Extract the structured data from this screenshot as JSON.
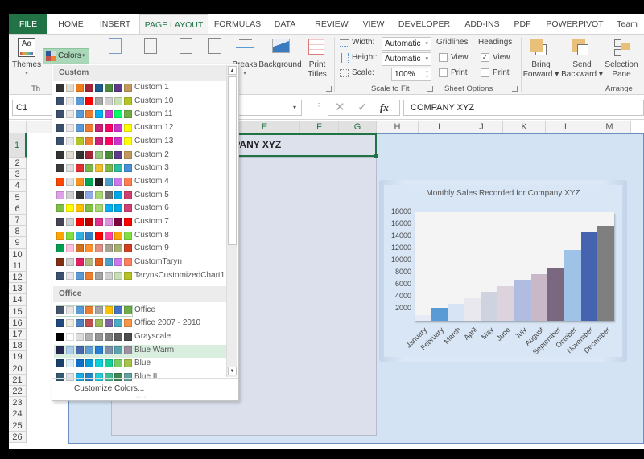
{
  "tabs": [
    "FILE",
    "HOME",
    "INSERT",
    "PAGE LAYOUT",
    "FORMULAS",
    "DATA",
    "REVIEW",
    "VIEW",
    "DEVELOPER",
    "ADD-INS",
    "PDF",
    "POWERPIVOT",
    "Team"
  ],
  "active_tab": "PAGE LAYOUT",
  "ribbon": {
    "themes_label": "Themes",
    "themes_group_label": "Th",
    "colors_label": "Colors",
    "breaks_label": "Breaks",
    "background_label": "Background",
    "print_titles_label": [
      "Print",
      "Titles"
    ],
    "scale_to_fit": {
      "width_label": "Width:",
      "width_value": "Automatic",
      "height_label": "Height:",
      "height_value": "Automatic",
      "scale_label": "Scale:",
      "scale_value": "100%",
      "group_label": "Scale to Fit"
    },
    "sheet_options": {
      "gridlines_label": "Gridlines",
      "headings_label": "Headings",
      "view_label": "View",
      "print_label": "Print",
      "gridlines_view": false,
      "gridlines_print": false,
      "headings_view": true,
      "headings_print": false,
      "group_label": "Sheet Options"
    },
    "arrange": {
      "bring_forward": [
        "Bring",
        "Forward"
      ],
      "send_backward": [
        "Send",
        "Backward"
      ],
      "selection_pane": [
        "Selection",
        "Pane"
      ],
      "group_label": "Arrange"
    }
  },
  "formula_bar": {
    "name_box": "C1",
    "formula": "COMPANY XYZ"
  },
  "columns": [
    "E",
    "F",
    "G",
    "H",
    "I",
    "J",
    "K",
    "L",
    "M"
  ],
  "rows": [
    "1",
    "2",
    "3",
    "4",
    "5",
    "6",
    "7",
    "8",
    "9",
    "10",
    "11",
    "12",
    "13",
    "14",
    "15",
    "16",
    "17",
    "18",
    "19",
    "20",
    "21",
    "22",
    "23",
    "24",
    "25",
    "26"
  ],
  "cell_c1_visible_text": "IPANY XYZ",
  "colors_dropdown": {
    "sections": [
      {
        "title": "Custom",
        "items": [
          {
            "name": "Custom 1",
            "swatches": [
              "#333333",
              "#e0dcd0",
              "#f07d1a",
              "#a32638",
              "#1d5c8a",
              "#4b8b3b",
              "#5e3b8a",
              "#c19a5b"
            ]
          },
          {
            "name": "Custom 10",
            "swatches": [
              "#3d4f6e",
              "#e8e8e8",
              "#5b9bd5",
              "#ff0000",
              "#a5a5a5",
              "#d0d0d0",
              "#c6e0b4",
              "#b5c425"
            ]
          },
          {
            "name": "Custom 11",
            "swatches": [
              "#3d4f6e",
              "#e8e8e8",
              "#5b9bd5",
              "#ed7d31",
              "#00b0f0",
              "#cc33cc",
              "#00ff66",
              "#70ad47"
            ]
          },
          {
            "name": "Custom 12",
            "swatches": [
              "#3d4f6e",
              "#e8e8e8",
              "#5b9bd5",
              "#ed7d31",
              "#cc1f7a",
              "#ff0066",
              "#cc33cc",
              "#ffff00"
            ]
          },
          {
            "name": "Custom 13",
            "swatches": [
              "#3d4f6e",
              "#e8e8e8",
              "#b5c425",
              "#ed7d31",
              "#cc1f7a",
              "#ff0066",
              "#cc33cc",
              "#ffff00"
            ]
          },
          {
            "name": "Custom 2",
            "swatches": [
              "#333333",
              "#e0dcd0",
              "#333333",
              "#a32638",
              "#93c47d",
              "#4b8b3b",
              "#5e3b8a",
              "#c19a5b"
            ]
          },
          {
            "name": "Custom 3",
            "swatches": [
              "#3b3b3b",
              "#dedede",
              "#e03030",
              "#7ab648",
              "#f0c030",
              "#7ab648",
              "#2bbfa0",
              "#4a90d9"
            ]
          },
          {
            "name": "Custom 4",
            "swatches": [
              "#ff4500",
              "#e0e0e0",
              "#f7931e",
              "#00a651",
              "#222222",
              "#4aa0c8",
              "#cc77ee",
              "#ff7f50"
            ]
          },
          {
            "name": "Custom 5",
            "swatches": [
              "#e0a0e8",
              "#d0d0d0",
              "#333333",
              "#8fa8e8",
              "#a8d870",
              "#707070",
              "#00a8e8",
              "#d04070"
            ]
          },
          {
            "name": "Custom 6",
            "swatches": [
              "#80c040",
              "#ffff00",
              "#ffc000",
              "#80c040",
              "#a8d870",
              "#00b0f0",
              "#00a8e8",
              "#d04070"
            ]
          },
          {
            "name": "Custom 7",
            "swatches": [
              "#444455",
              "#d0d0d0",
              "#ff0000",
              "#c00000",
              "#e03090",
              "#e090e0",
              "#800040",
              "#ff0000"
            ]
          },
          {
            "name": "Custom 8",
            "swatches": [
              "#ffa500",
              "#80e040",
              "#30b0e0",
              "#3080c8",
              "#ff0000",
              "#ff40a0",
              "#ffa500",
              "#80e040"
            ]
          },
          {
            "name": "Custom 9",
            "swatches": [
              "#00a050",
              "#ffc0e0",
              "#d07020",
              "#ff9030",
              "#e09080",
              "#a8a090",
              "#a8b070",
              "#d04020"
            ]
          },
          {
            "name": "CustomTaryn",
            "swatches": [
              "#803010",
              "#d0d0d0",
              "#e02060",
              "#b0b880",
              "#e06020",
              "#4aa0c8",
              "#cc77ee",
              "#ff8060"
            ]
          },
          {
            "name": "TarynsCustomizedChart1",
            "swatches": [
              "#3d4f6e",
              "#e8e8e8",
              "#5b9bd5",
              "#ed7d31",
              "#a5a5a5",
              "#d0d0d0",
              "#c6e0b4",
              "#b5c425"
            ]
          }
        ]
      },
      {
        "title": "Office",
        "items": [
          {
            "name": "Office",
            "swatches": [
              "#44546a",
              "#e7e6e6",
              "#5b9bd5",
              "#ed7d31",
              "#a5a5a5",
              "#ffc000",
              "#4472c4",
              "#70ad47"
            ]
          },
          {
            "name": "Office 2007 - 2010",
            "swatches": [
              "#1f497d",
              "#eeece1",
              "#4f81bd",
              "#c0504d",
              "#9bbb59",
              "#8064a2",
              "#4bacc6",
              "#f79646"
            ]
          },
          {
            "name": "Grayscale",
            "swatches": [
              "#000000",
              "#ffffff",
              "#dddddd",
              "#b2b2b2",
              "#969696",
              "#808080",
              "#5f5f5f",
              "#4d4d4d"
            ]
          },
          {
            "name": "Blue Warm",
            "swatches": [
              "#242852",
              "#acccea",
              "#4a66ac",
              "#629dd1",
              "#297fd5",
              "#7f8fa9",
              "#5aa2ae",
              "#9d90a0"
            ]
          },
          {
            "name": "Blue",
            "swatches": [
              "#17406d",
              "#dbeff9",
              "#0f6fc6",
              "#009dd9",
              "#0bd0d9",
              "#10cf9b",
              "#7cca62",
              "#a5c249"
            ]
          },
          {
            "name": "Blue II",
            "swatches": [
              "#335b74",
              "#dfe3e5",
              "#1cade4",
              "#2683c6",
              "#27ced7",
              "#42ba97",
              "#3e8853",
              "#62a39f"
            ]
          }
        ]
      }
    ],
    "highlighted": "Blue Warm",
    "current": "Office",
    "customize_label": "Customize Colors..."
  },
  "chart_data": {
    "type": "bar",
    "title": "Monthly Sales Recorded for Company XYZ",
    "categories": [
      "January",
      "February",
      "March",
      "April",
      "May",
      "June",
      "July",
      "August",
      "September",
      "October",
      "November",
      "December"
    ],
    "values": [
      1000,
      2200,
      2800,
      3800,
      4800,
      5800,
      6800,
      7800,
      8800,
      11800,
      14800,
      15800
    ],
    "bar_colors": [
      "#e6ebf5",
      "#5b9bd5",
      "#d6e4f5",
      "#e8e8ee",
      "#cfd3e0",
      "#ddd3dc",
      "#b1bde0",
      "#c8b8c8",
      "#7a6880",
      "#9ec3e6",
      "#4563ae",
      "#7f7f7f"
    ],
    "xlabel": "",
    "ylabel": "",
    "yticks": [
      2000,
      4000,
      6000,
      8000,
      10000,
      12000,
      14000,
      16000,
      18000
    ],
    "ylim": [
      0,
      18000
    ],
    "grid": false,
    "legend": "none"
  }
}
